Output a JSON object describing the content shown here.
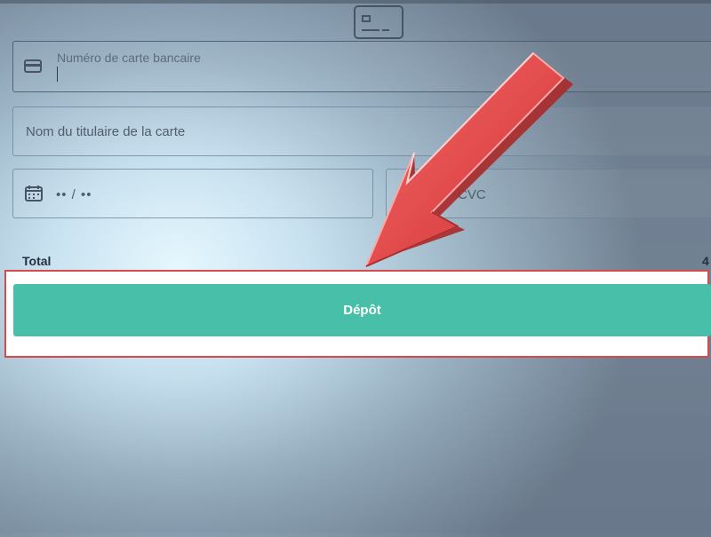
{
  "payment_form": {
    "card_number_label": "Numéro de carte bancaire",
    "cardholder_placeholder": "Nom du titulaire de la carte",
    "expiry_placeholder": "•• / ••",
    "cvc_placeholder": "CVC",
    "total_label": "Total",
    "total_value_partial": "4",
    "submit_label": "Dépôt"
  },
  "icons": {
    "top": "credit-card-icon",
    "card_number": "credit-card-icon",
    "expiry": "calendar-icon",
    "overlay_arrow": "red-arrow-icon"
  },
  "colors": {
    "accent": "#47bfa9",
    "highlight": "#d84a4a",
    "arrow": "#e14a4a"
  }
}
